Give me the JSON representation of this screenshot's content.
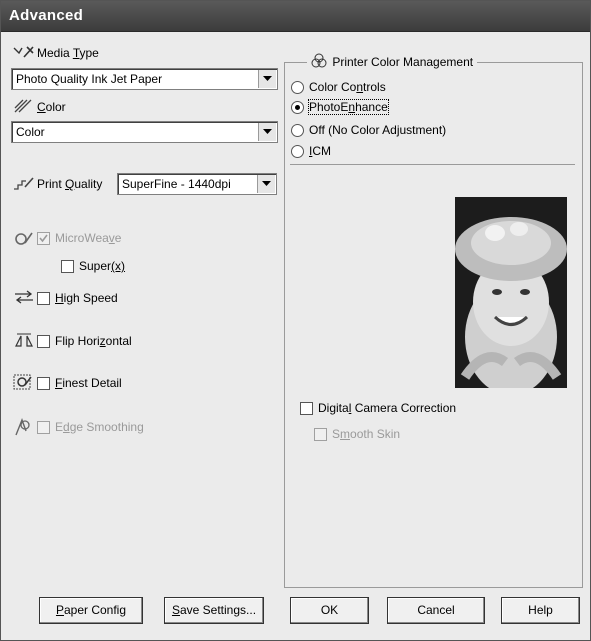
{
  "window": {
    "title": "Advanced"
  },
  "media_type": {
    "label": "Media Type",
    "value": "Photo Quality Ink Jet Paper"
  },
  "color": {
    "label": "Color",
    "value": "Color"
  },
  "print_quality": {
    "label": "Print Quality",
    "value": "SuperFine - 1440dpi"
  },
  "options": {
    "microweave": {
      "label": "MicroWeave",
      "checked": true,
      "enabled": false
    },
    "super": {
      "label": "Super(x)",
      "checked": false
    },
    "high_speed": {
      "label": "High Speed",
      "checked": false
    },
    "flip_horizontal": {
      "label": "Flip Horizontal",
      "checked": false
    },
    "finest_detail": {
      "label": "Finest Detail",
      "checked": false
    },
    "edge_smoothing": {
      "label": "Edge Smoothing",
      "checked": false,
      "enabled": false
    }
  },
  "color_management": {
    "title": "Printer Color Management",
    "radios": [
      {
        "label": "Color Controls",
        "selected": false
      },
      {
        "label": "PhotoEnhance",
        "selected": true
      },
      {
        "label": "Off (No Color Adjustment)",
        "selected": false
      },
      {
        "label": "ICM",
        "selected": false
      }
    ],
    "digital_camera_correction": "Digital Camera Correction",
    "smooth_skin": "Smooth Skin"
  },
  "buttons": {
    "paper_config": "Paper Config",
    "save_settings": "Save Settings...",
    "ok": "OK",
    "cancel": "Cancel",
    "help": "Help"
  },
  "icons": [
    "media-type-icon",
    "color-icon",
    "print-quality-icon",
    "microweave-icon",
    "high-speed-icon",
    "flip-horizontal-icon",
    "finest-detail-icon",
    "edge-smoothing-icon",
    "color-management-icon",
    "preview-photo"
  ]
}
